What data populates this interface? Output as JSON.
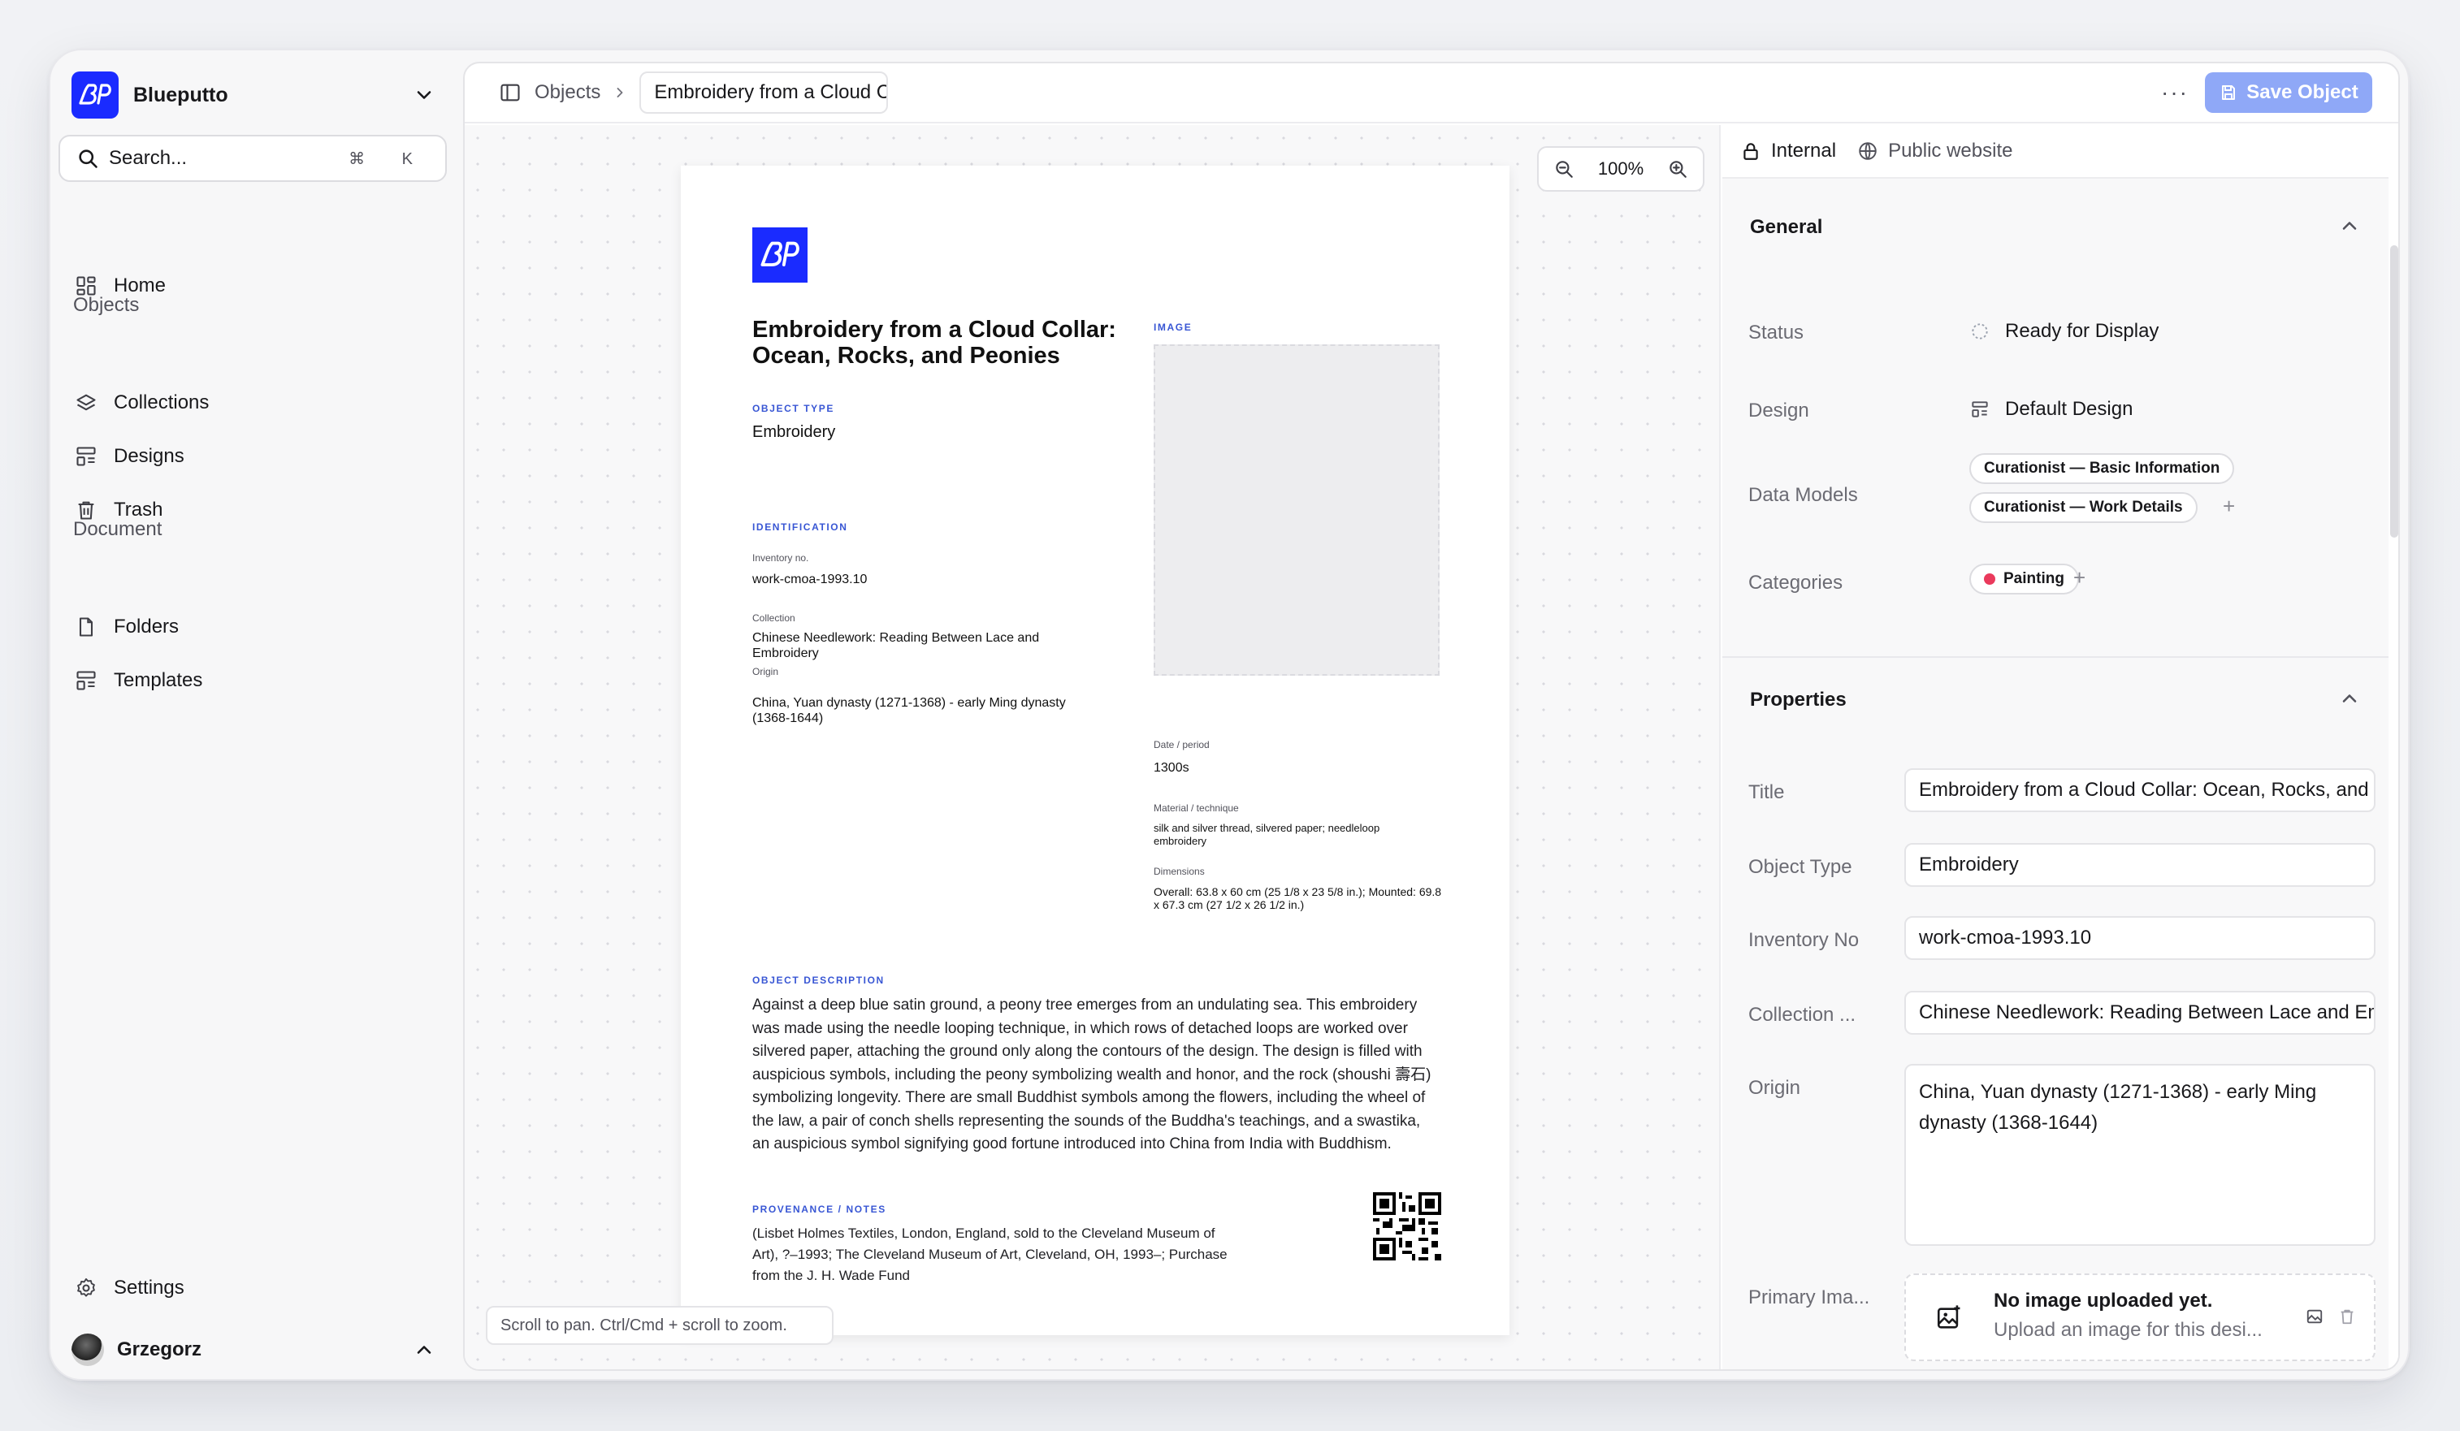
{
  "app": {
    "name": "Blueputto",
    "search_placeholder": "Search...",
    "search_shortcut": "⌘ K"
  },
  "sidebar": {
    "home": "Home",
    "objects_section": "Objects",
    "objects_items": [
      "Collections",
      "Designs",
      "Trash"
    ],
    "document_section": "Document",
    "document_items": [
      "Folders",
      "Templates"
    ],
    "settings": "Settings",
    "user": "Grzegorz"
  },
  "topbar": {
    "breadcrumb_root": "Objects",
    "breadcrumb_current": "Embroidery from a Cloud Collar: Ocean, Rocks, and Peonies",
    "more": "···",
    "save_label": "Save Object"
  },
  "canvas": {
    "zoom_level": "100%",
    "hint": "Scroll to pan. Ctrl/Cmd + scroll to zoom."
  },
  "document": {
    "title": "Embroidery from a Cloud Collar: Ocean, Rocks, and Peonies",
    "image_label": "IMAGE",
    "object_type_label": "OBJECT TYPE",
    "object_type": "Embroidery",
    "identification_label": "IDENTIFICATION",
    "inventory_label": "Inventory no.",
    "inventory": "work-cmoa-1993.10",
    "collection_label": "Collection",
    "collection": "Chinese Needlework: Reading Between Lace and Embroidery",
    "origin_label": "Origin",
    "origin": "China, Yuan dynasty (1271-1368) - early Ming dynasty (1368-1644)",
    "date_label": "Date / period",
    "date": "1300s",
    "material_label": "Material / technique",
    "material": "silk and silver thread, silvered paper; needleloop embroidery",
    "dimensions_label": "Dimensions",
    "dimensions": "Overall: 63.8 x 60 cm (25 1/8 x 23 5/8 in.); Mounted: 69.8 x 67.3 cm (27 1/2 x 26 1/2 in.)",
    "description_label": "OBJECT DESCRIPTION",
    "description": "Against a deep blue satin ground, a peony tree emerges from an undulating sea. This embroidery was made using the needle looping technique, in which rows of detached loops are worked over silvered paper, attaching the ground only along the contours of the design. The design is filled with auspicious symbols, including the peony symbolizing wealth and honor, and the rock (shoushi 壽石) symbolizing longevity. There are small Buddhist symbols among the flowers, including the wheel of the law, a pair of conch shells representing the sounds of the Buddha's teachings, and a swastika, an auspicious symbol signifying good fortune introduced into China from India with Buddhism.",
    "provenance_label": "PROVENANCE / NOTES",
    "provenance": "(Lisbet Holmes Textiles, London, England, sold to the Cleveland Museum of Art), ?–1993; The Cleveland Museum of Art, Cleveland, OH, 1993–; Purchase from the J. H. Wade Fund"
  },
  "panel": {
    "tabs": [
      "Internal",
      "Public website"
    ],
    "general": {
      "heading": "General",
      "status_label": "Status",
      "status_value": "Ready for Display",
      "design_label": "Design",
      "design_value": "Default Design",
      "data_models_label": "Data Models",
      "data_models": [
        "Curationist — Basic Information",
        "Curationist — Work Details"
      ],
      "categories_label": "Categories",
      "categories": [
        "Painting"
      ]
    },
    "properties": {
      "heading": "Properties",
      "title_label": "Title",
      "title_value": "Embroidery from a Cloud Collar: Ocean, Rocks, and Peonies",
      "object_type_label": "Object Type",
      "object_type_value": "Embroidery",
      "inventory_label": "Inventory No",
      "inventory_value": "work-cmoa-1993.10",
      "collection_label": "Collection ...",
      "collection_value": "Chinese Needlework: Reading Between Lace and Embroidery",
      "origin_label": "Origin",
      "origin_value": "China, Yuan dynasty (1271-1368) - early Ming dynasty (1368-1644)",
      "primary_image_label": "Primary Ima...",
      "upload_title": "No image uploaded yet.",
      "upload_subtitle": "Upload an image for this desi..."
    }
  },
  "colors": {
    "brand": "#1a2bff",
    "save_button": "#8fa8f7",
    "doc_label": "#3856d4",
    "category_dot": "#ea3a5c"
  }
}
